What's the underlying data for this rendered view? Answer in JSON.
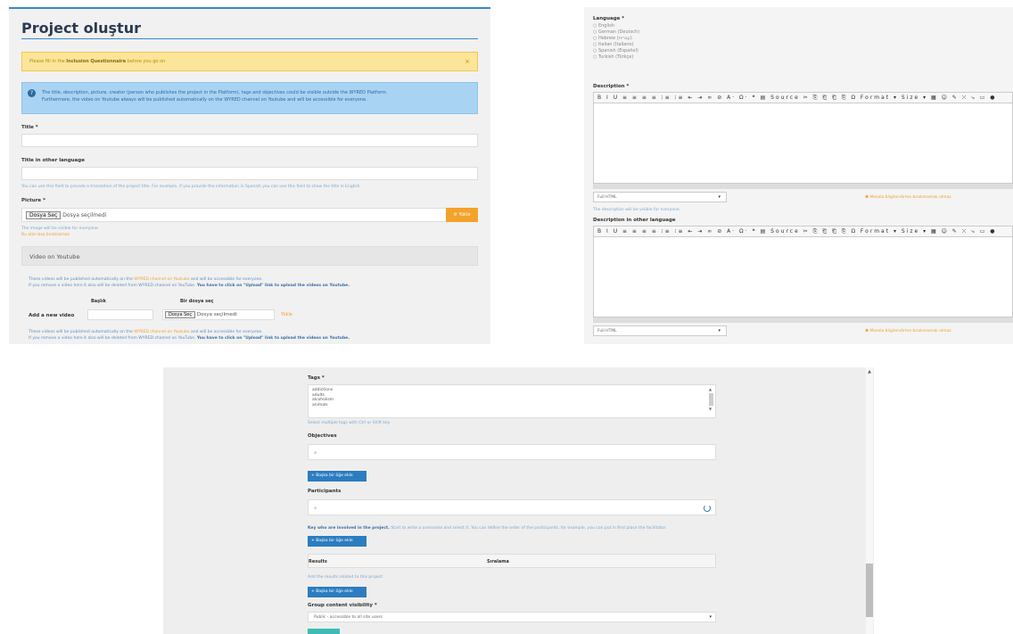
{
  "panel1": {
    "title": "Project oluştur",
    "warning_prefix": "Please fill in the ",
    "warning_bold": "Inclusion Questionnaire",
    "warning_suffix": " before you go on",
    "warning_close": "×",
    "info_line1": "The title, description, picture, creator (person who publishes the project in the Platform), tags and objectives could be visible outside the WYRED Platform.",
    "info_line2": "Furthermore, the video on Youtube always will be published automatically on the WYRED channel on Youtube and will be accessible for everyone.",
    "title_label": "Title *",
    "title_other_label": "Title in other language",
    "title_other_hint": "You can use this field to provide a translation of the project title. For example, if you provide the information in Spanish you can use this field to show the title in English.",
    "picture_label": "Picture *",
    "file_button": "Dosya Seç",
    "file_none": "Dosya seçilmedi",
    "upload_label": "Yükle",
    "picture_hint": "The image will be visible for everyone.",
    "picture_warning": "Bu alan boş bırakılamaz",
    "video_section": "Video on Youtube",
    "video_note1a": "These videos will be published automatically on the ",
    "video_note1b": "WYRED channel on Youtube",
    "video_note1c": " and will be accessible for everyone.",
    "video_note2a": "If you remove a video here it also will be deleted from WYRED channel on YouTube. ",
    "video_note2b": "You have to click on \"Upload\" link to upload the videos on Youtube.",
    "col_title": "Başlık",
    "col_file": "Bir dosya seç",
    "add_video_label": "Add a new video",
    "add_video_upload": "Yükle"
  },
  "panel2": {
    "language_label": "Language *",
    "languages": [
      "English",
      "German (Deutsch)",
      "Hebrew (עברית)",
      "Italian (Italiano)",
      "Spanish (Español)",
      "Turkish (Türkçe)"
    ],
    "description_label": "Description *",
    "toolbar": "B I U ≡ ≡ ≡ ≡ ⁝≡ ⁝≡ ⇤ ⇥ ∞ ⊘ A· Ω· ❝ ▤ Source ✂ ⎘ ⎗ ⎗ ⎘ Ω  Format ▾  Size ▾  ▦ ☺ ✎ ⤫ ⤷ ▭ ●",
    "format_select": "Full HTML",
    "format_chev": "▾",
    "desc_hint": "The description will be visible for everyone.",
    "warning": "❶ Mesela bilgilendirme bırakmamak olmaz",
    "desc_other_label": "Description in other language"
  },
  "panel3": {
    "tags_label": "Tags *",
    "tags": [
      "addictions",
      "adults",
      "alcoholism",
      "animals"
    ],
    "tags_hint": "Select multiple tags with Ctrl or Shift key",
    "objectives_label": "Objectives",
    "objectives_placeholder": "a",
    "add_item_label": "+ Başka bir öğe ekle",
    "participants_label": "Participants",
    "participants_placeholder": "a",
    "participants_hint_bold": "Key who are involved in the project.",
    "participants_hint": " Start to write a username and select it. You can define the order of the participants, for example, you can put in first place the facilitator.",
    "results_col1": "Results",
    "results_col2": "Sıralama",
    "results_hint": "Add the results related to this project",
    "visibility_label": "Group content visibility *",
    "visibility_value": "Public - accessible to all site users",
    "visibility_chev": "▾",
    "scroll_up": "▲",
    "scroll_down": "▼",
    "page_scroll_up": "▲"
  }
}
